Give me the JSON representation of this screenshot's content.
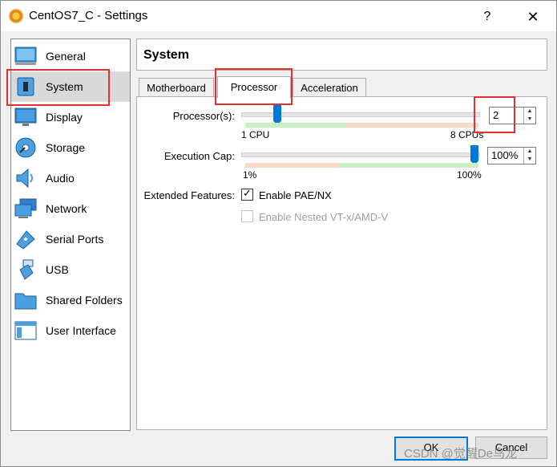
{
  "window": {
    "title": "CentOS7_C - Settings",
    "help_label": "?",
    "close_label": "✕"
  },
  "sidebar": {
    "items": [
      {
        "label": "General",
        "icon": "general-icon"
      },
      {
        "label": "System",
        "icon": "chip-icon"
      },
      {
        "label": "Display",
        "icon": "monitor-icon"
      },
      {
        "label": "Storage",
        "icon": "disk-icon"
      },
      {
        "label": "Audio",
        "icon": "speaker-icon"
      },
      {
        "label": "Network",
        "icon": "network-icon"
      },
      {
        "label": "Serial Ports",
        "icon": "serial-port-icon"
      },
      {
        "label": "USB",
        "icon": "usb-icon"
      },
      {
        "label": "Shared Folders",
        "icon": "folder-icon"
      },
      {
        "label": "User Interface",
        "icon": "window-icon"
      }
    ],
    "selected": "System"
  },
  "header": {
    "title": "System"
  },
  "tabs": [
    {
      "label": "Motherboard"
    },
    {
      "label": "Processor"
    },
    {
      "label": "Acceleration"
    }
  ],
  "active_tab": "Processor",
  "processor": {
    "label": "Processor(s):",
    "value": "2",
    "min_label": "1 CPU",
    "max_label": "8 CPUs",
    "level": 0.14
  },
  "exec_cap": {
    "label": "Execution Cap:",
    "value": "100%",
    "min_label": "1%",
    "max_label": "100%",
    "level": 1.0
  },
  "extended": {
    "label": "Extended Features:",
    "pae_label": "Enable PAE/NX",
    "pae_checked": true,
    "vtx_label": "Enable Nested VT-x/AMD-V",
    "vtx_checked": false
  },
  "buttons": {
    "ok": "OK",
    "cancel": "Cancel"
  },
  "watermark": "CSDN @觉醒De鸟龙",
  "colors": {
    "accent": "#0078d7",
    "highlight": "#e03030",
    "good_zone": "#c8f0c0",
    "bad_zone": "#f8d8c8"
  }
}
